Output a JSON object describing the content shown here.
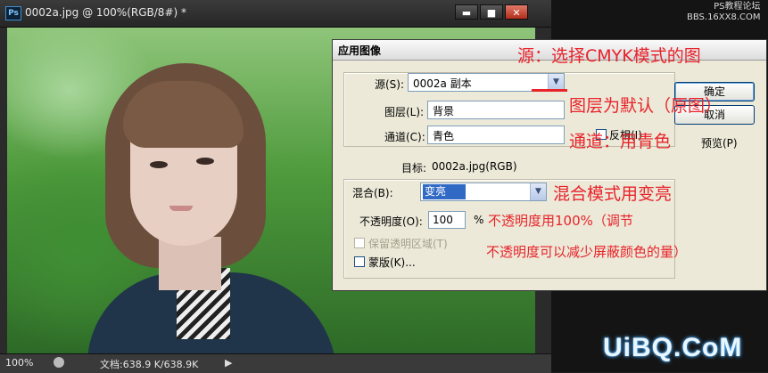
{
  "window": {
    "app_icon": "Ps",
    "title": "0002a.jpg @ 100%(RGB/8#) *",
    "minimize": "▬",
    "maximize": "■",
    "close": "✕"
  },
  "status_bar": {
    "zoom": "100%",
    "doc_info": "文档:638.9 K/638.9K",
    "arrow": "▶"
  },
  "watermarks": {
    "forum_line1": "PS教程论坛",
    "forum_line2": "BBS.16XX8.COM",
    "site": "UiBQ.CoM"
  },
  "dialog": {
    "title": "应用图像",
    "source_label": "源(S):",
    "source_value": "0002a 副本",
    "layer_label": "图层(L):",
    "layer_value": "背景",
    "channel_label": "通道(C):",
    "channel_value": "青色",
    "invert_label": "反相(I)",
    "target_label": "目标:",
    "target_value": "0002a.jpg(RGB)",
    "blend_label": "混合(B):",
    "blend_value": "变亮",
    "opacity_label": "不透明度(O):",
    "opacity_value": "100",
    "opacity_unit": "%",
    "preserve_label": "保留透明区域(T)",
    "mask_label": "蒙版(K)...",
    "ok_label": "确定",
    "cancel_label": "取消",
    "preview_label": "预览(P)"
  },
  "annotations": {
    "source": "源：选择CMYK模式的图",
    "layer": "图层为默认（原图）",
    "channel": "通道：用青色",
    "blend": "混合模式用变亮",
    "opacity_1": "不透明度用100%（调节",
    "opacity_2": "不透明度可以减少屏蔽颜色的量）"
  },
  "colors": {
    "annotation": "#e8232a",
    "dialog_bg": "#ece9d8",
    "selection": "#316ac5"
  }
}
